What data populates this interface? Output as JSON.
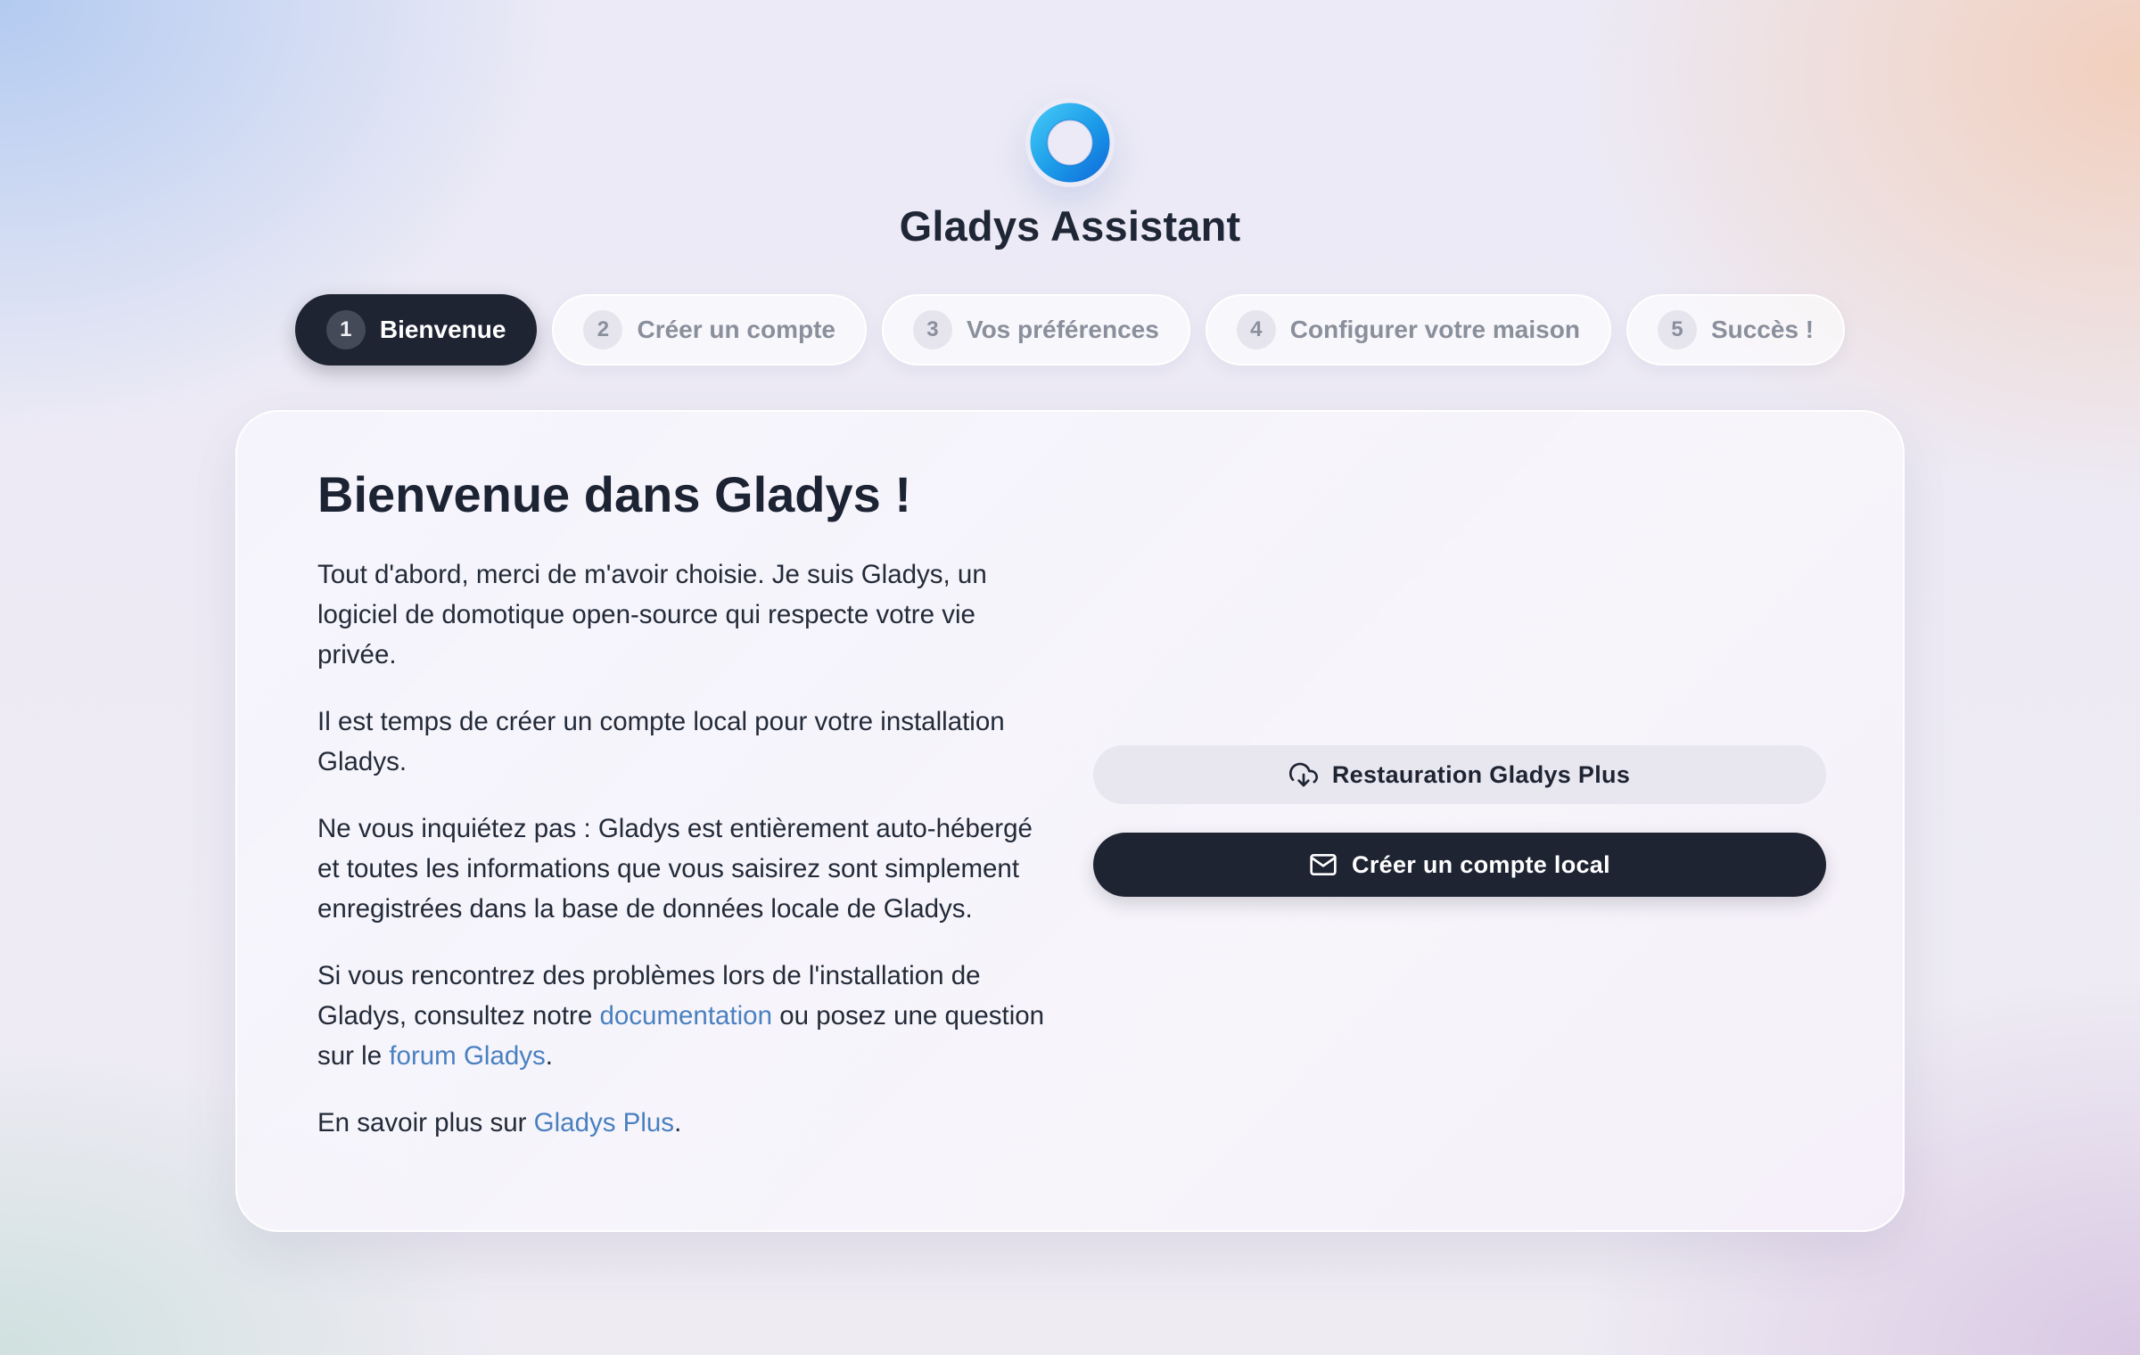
{
  "header": {
    "logo_icon": "gladys-logo-icon",
    "app_title": "Gladys Assistant"
  },
  "steps": [
    {
      "number": "1",
      "label": "Bienvenue",
      "active": true
    },
    {
      "number": "2",
      "label": "Créer un compte",
      "active": false
    },
    {
      "number": "3",
      "label": "Vos préférences",
      "active": false
    },
    {
      "number": "4",
      "label": "Configurer votre maison",
      "active": false
    },
    {
      "number": "5",
      "label": "Succès !",
      "active": false
    }
  ],
  "welcome": {
    "title": "Bienvenue dans Gladys !",
    "p1": "Tout d'abord, merci de m'avoir choisie. Je suis Gladys, un logiciel de domotique open-source qui respecte votre vie privée.",
    "p2": "Il est temps de créer un compte local pour votre installation Gladys.",
    "p3": "Ne vous inquiétez pas : Gladys est entièrement auto-hébergé et toutes les informations que vous saisirez sont simplement enregistrées dans la base de données locale de Gladys.",
    "p4_before": "Si vous rencontrez des problèmes lors de l'installation de Gladys, consultez notre ",
    "p4_doc_link": "documentation",
    "p4_middle": " ou posez une question sur le ",
    "p4_forum_link": "forum Gladys",
    "p4_after": ".",
    "p5_before": "En savoir plus sur ",
    "p5_link": "Gladys Plus",
    "p5_after": "."
  },
  "actions": {
    "restore_label": "Restauration Gladys Plus",
    "restore_icon": "cloud-download-icon",
    "create_label": "Créer un compte local",
    "create_icon": "mail-icon"
  },
  "colors": {
    "primary_dark": "#1f2433",
    "link": "#4a80c0",
    "logo_light": "#3fc3f5",
    "logo_dark": "#1273de"
  }
}
